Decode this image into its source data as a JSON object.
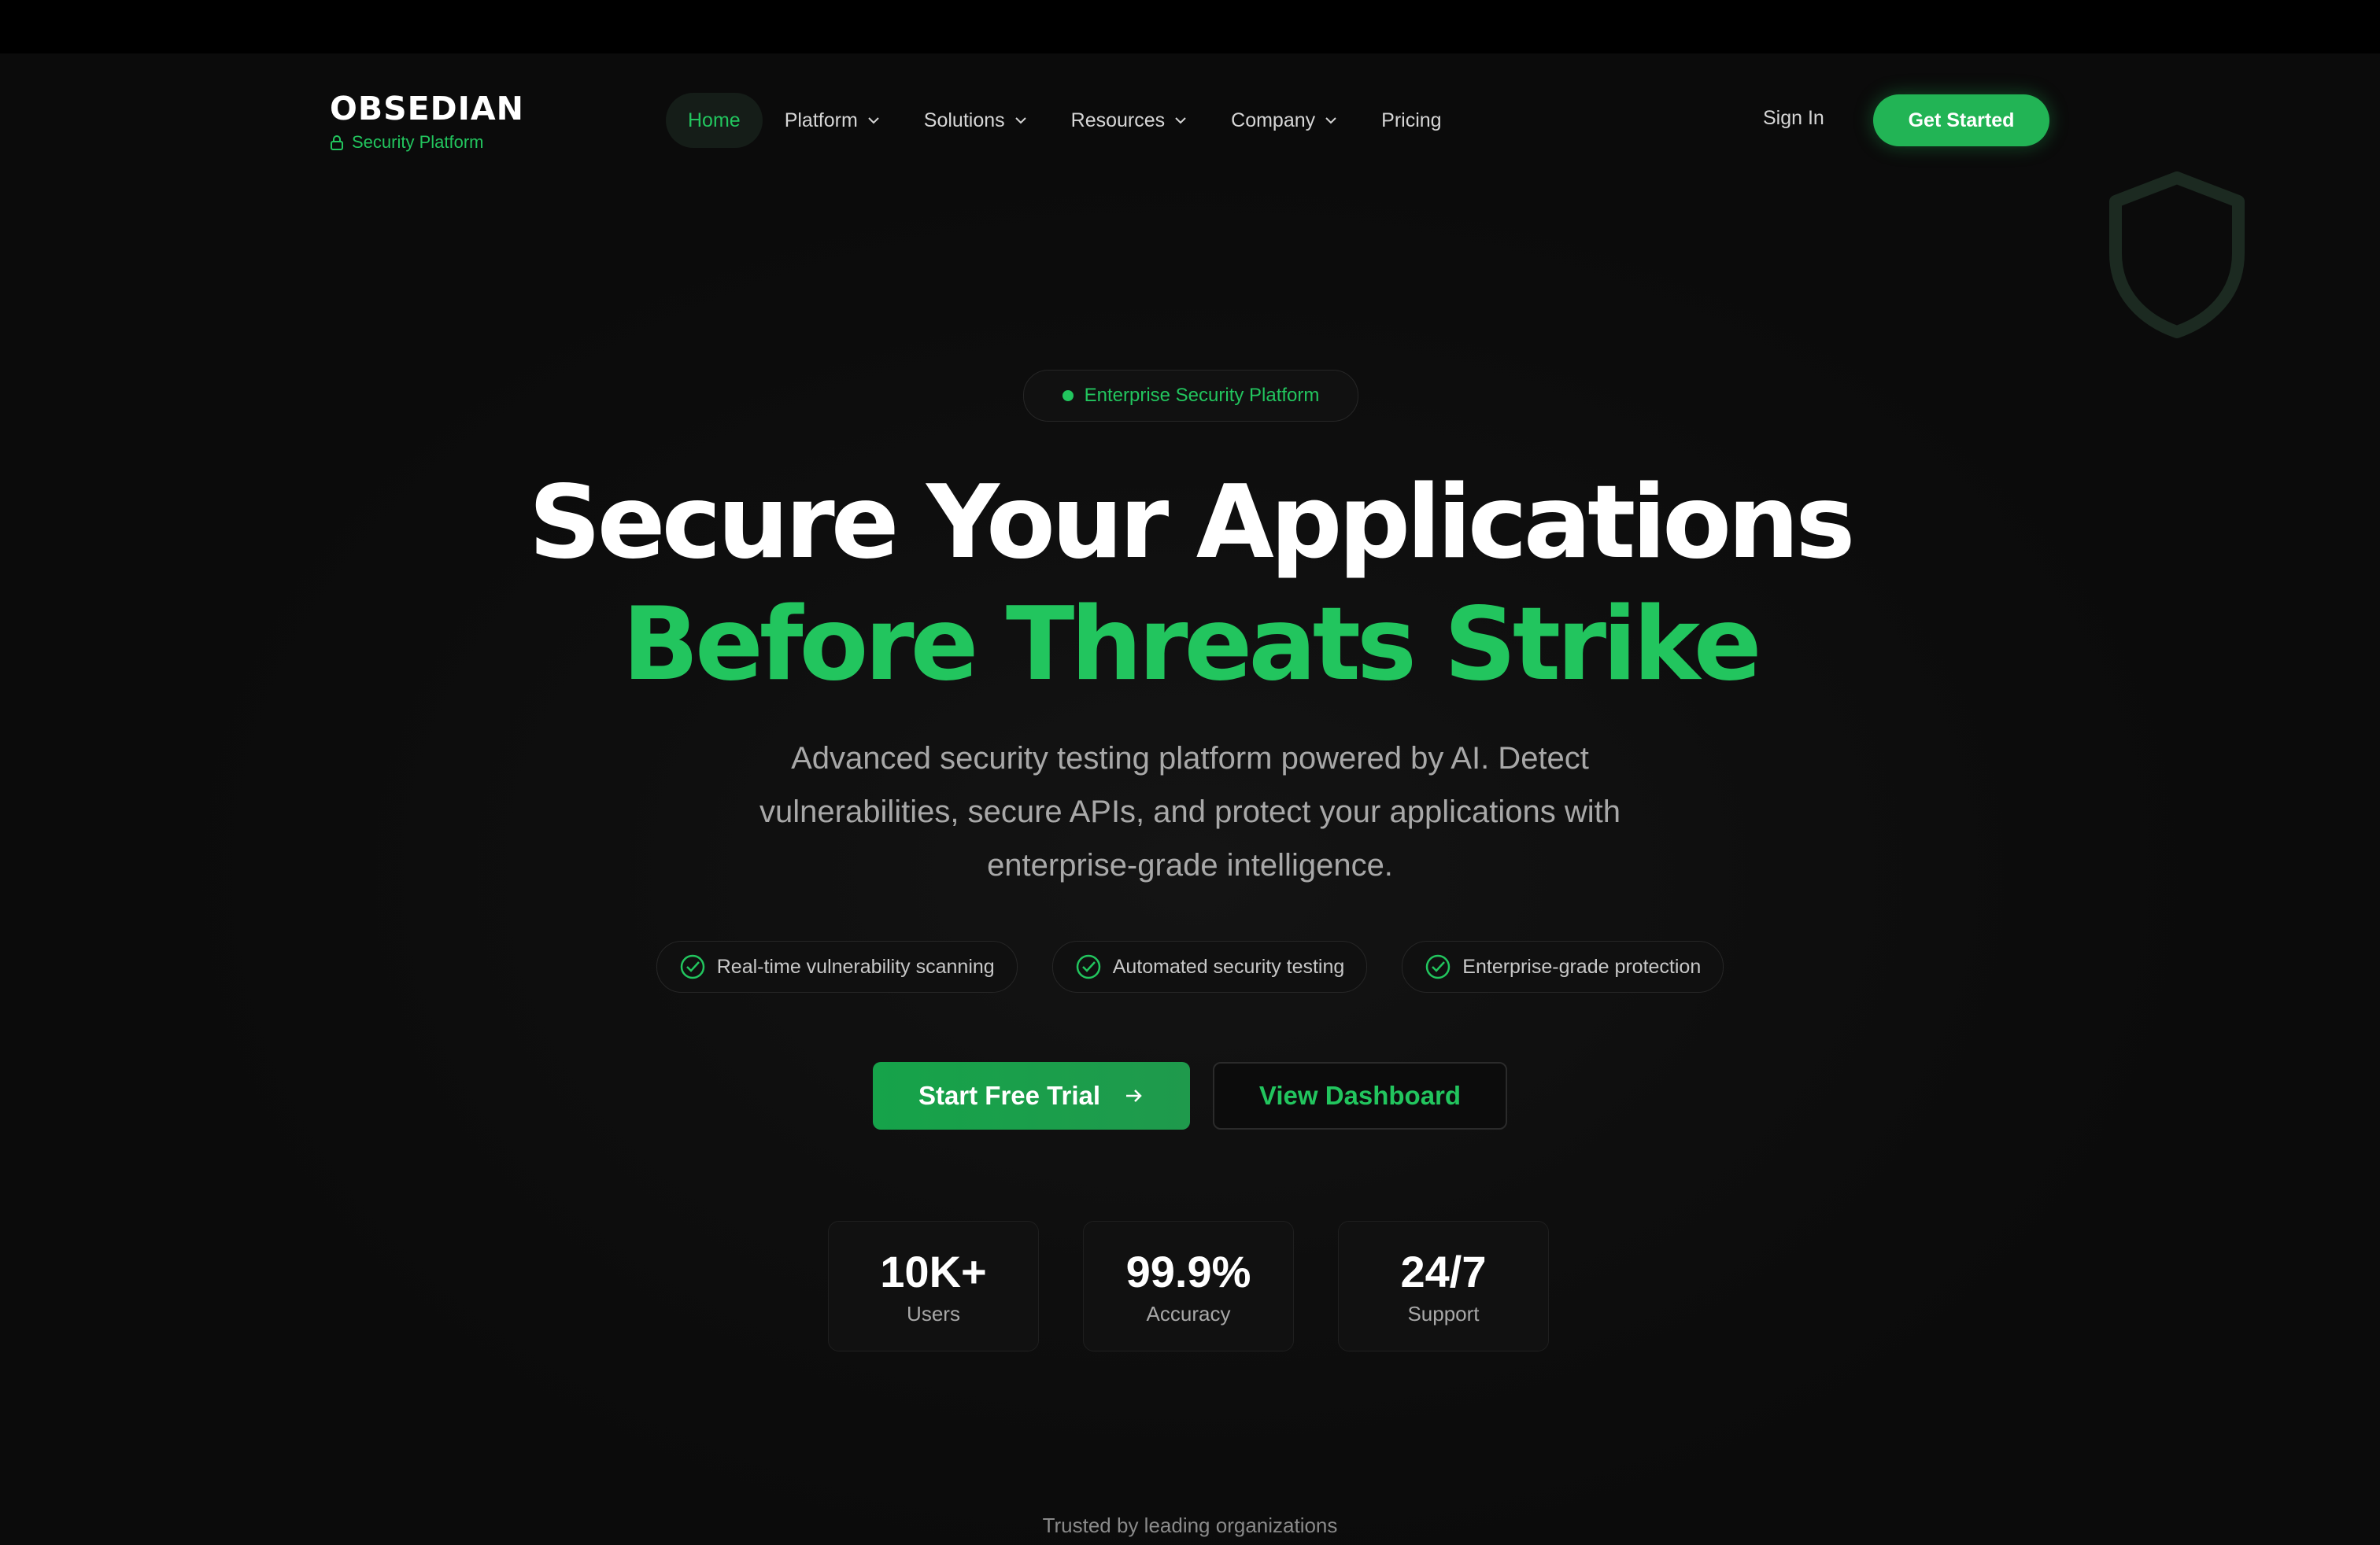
{
  "brand": {
    "name": "OBSEDIAN",
    "tagline": "Security Platform",
    "accent": "#22c55e"
  },
  "nav": {
    "items": [
      {
        "label": "Home",
        "active": true,
        "dropdown": false
      },
      {
        "label": "Platform",
        "active": false,
        "dropdown": true
      },
      {
        "label": "Solutions",
        "active": false,
        "dropdown": true
      },
      {
        "label": "Resources",
        "active": false,
        "dropdown": true
      },
      {
        "label": "Company",
        "active": false,
        "dropdown": true
      },
      {
        "label": "Pricing",
        "active": false,
        "dropdown": false
      }
    ],
    "sign_in": "Sign In",
    "get_started": "Get Started"
  },
  "hero": {
    "badge": "Enterprise Security Platform",
    "headline_line1": "Secure Your Applications",
    "headline_line2": "Before Threats Strike",
    "subtext": "Advanced security testing platform powered by AI. Detect vulnerabilities, secure APIs, and protect your applications with enterprise-grade intelligence.",
    "features": [
      "Real-time vulnerability scanning",
      "Automated security testing",
      "Enterprise-grade protection"
    ],
    "primary_cta": "Start Free Trial",
    "secondary_cta": "View Dashboard"
  },
  "stats": [
    {
      "value": "10K+",
      "label": "Users"
    },
    {
      "value": "99.9%",
      "label": "Accuracy"
    },
    {
      "value": "24/7",
      "label": "Support"
    }
  ],
  "trusted_text": "Trusted by leading organizations",
  "icons": {
    "lock": "lock-icon",
    "chevron": "chevron-down-icon",
    "shield": "shield-icon",
    "check": "check-circle-icon",
    "arrow": "arrow-right-icon"
  }
}
